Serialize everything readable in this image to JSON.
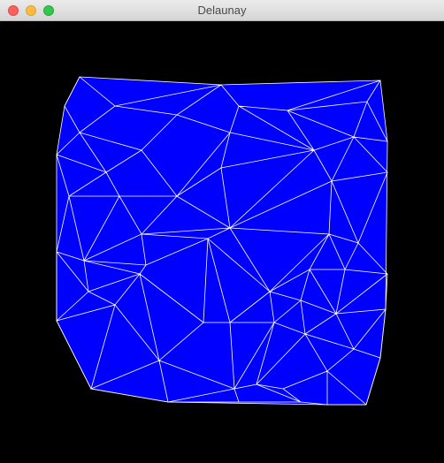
{
  "window": {
    "title": "Delaunay"
  },
  "colors": {
    "background": "#000000",
    "fill": "#0000ff",
    "edges": "#ffffff"
  }
}
